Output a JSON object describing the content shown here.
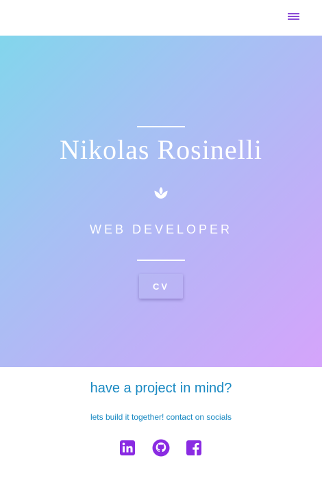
{
  "header": {
    "menu_icon": "hamburger-menu-icon",
    "accent_color": "#8a49d6"
  },
  "hero": {
    "name": "Nikolas Rosinelli",
    "emblem_icon": "lotus-icon",
    "role": "WEB DEVELOPER",
    "cv_button_label": "CV",
    "gradient_colors": [
      "#82d6ec",
      "#bbb2f7",
      "#d5a4fb"
    ]
  },
  "contact": {
    "headline": "have a project in mind?",
    "subline": "lets build it together! contact on socials",
    "text_color": "#1989c2",
    "socials": [
      {
        "icon": "linkedin-icon"
      },
      {
        "icon": "github-icon"
      },
      {
        "icon": "facebook-icon"
      }
    ],
    "social_color": "#8a2be2"
  }
}
